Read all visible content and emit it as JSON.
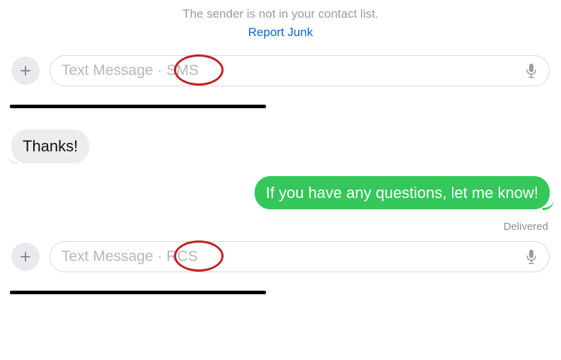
{
  "notice": "The sender is not in your contact list.",
  "report_junk": "Report Junk",
  "compose": {
    "placeholder_sms": "Text Message · SMS",
    "placeholder_rcs": "Text Message · RCS"
  },
  "messages": {
    "received": "Thanks!",
    "sent": "If you have any questions, let me know!",
    "status": "Delivered"
  },
  "annotations": {
    "circled_label_1": "SMS",
    "circled_label_2": "RCS"
  }
}
